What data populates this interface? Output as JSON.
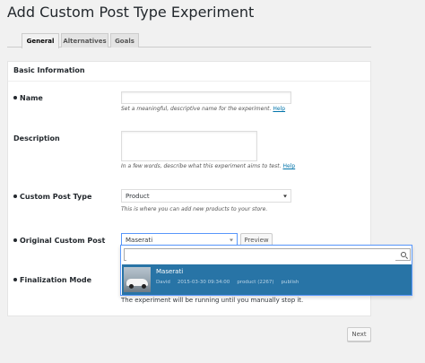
{
  "page": {
    "title": "Add Custom Post Type Experiment"
  },
  "tabs": [
    {
      "label": "General",
      "active": true
    },
    {
      "label": "Alternatives",
      "active": false
    },
    {
      "label": "Goals",
      "active": false
    }
  ],
  "section": {
    "title": "Basic Information"
  },
  "fields": {
    "name": {
      "label": "Name",
      "required": true,
      "value": "",
      "help": "Set a meaningful, descriptive name for the experiment.",
      "help_link": "Help"
    },
    "description": {
      "label": "Description",
      "required": false,
      "value": "",
      "help": "In a few words, describe what this experiment aims to test.",
      "help_link": "Help"
    },
    "post_type": {
      "label": "Custom Post Type",
      "required": true,
      "value": "Product",
      "help": "This is where you can add new products to your store."
    },
    "original_post": {
      "label": "Original Custom Post",
      "required": true,
      "value": "Maserati",
      "preview_label": "Preview"
    },
    "finalization": {
      "label": "Finalization Mode",
      "required": true,
      "text": "The experiment will be running until you manually stop it."
    }
  },
  "dropdown": {
    "search_value": "",
    "results": [
      {
        "title": "Maserati",
        "author": "David",
        "date": "2015-03-30 09:34:00",
        "type": "product (2267)",
        "status": "publish"
      }
    ]
  },
  "footer": {
    "next_label": "Next"
  },
  "colors": {
    "background": "#f1f1f1",
    "highlight": "#2874a6",
    "link": "#0073aa"
  }
}
